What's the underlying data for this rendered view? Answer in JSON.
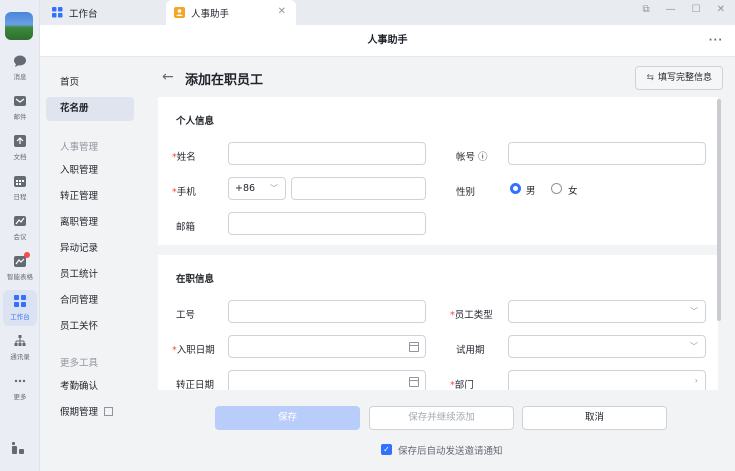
{
  "rail": {
    "items": [
      {
        "label": "消息",
        "icon": "chat-bubble-icon"
      },
      {
        "label": "邮件",
        "icon": "mail-icon"
      },
      {
        "label": "文档",
        "icon": "document-icon"
      },
      {
        "label": "日程",
        "icon": "calendar-icon"
      },
      {
        "label": "会议",
        "icon": "meeting-icon"
      },
      {
        "label": "智能表格",
        "icon": "smart-table-icon"
      },
      {
        "label": "工作台",
        "icon": "workbench-icon"
      },
      {
        "label": "通讯录",
        "icon": "contacts-icon"
      },
      {
        "label": "更多",
        "icon": "more-icon"
      }
    ]
  },
  "tabs": [
    {
      "label": "工作台"
    },
    {
      "label": "人事助手"
    }
  ],
  "app_title": "人事助手",
  "app_more": "···",
  "subnav": {
    "home": "首页",
    "roster": "花名册",
    "group_hr": "人事管理",
    "onboard": "入职管理",
    "regular": "转正管理",
    "leave": "离职管理",
    "change": "异动记录",
    "stats": "员工统计",
    "contract": "合同管理",
    "care": "员工关怀",
    "group_tools": "更多工具",
    "attendance": "考勤确认",
    "holiday": "假期管理"
  },
  "page": {
    "title": "添加在职员工",
    "fill_button": "填写完整信息"
  },
  "personal": {
    "title": "个人信息",
    "name_label": "姓名",
    "account_label": "帐号 ⓘ",
    "phone_label": "手机",
    "phone_code": "+86",
    "gender_label": "性别",
    "gender_male": "男",
    "gender_female": "女",
    "email_label": "邮箱"
  },
  "job": {
    "title": "在职信息",
    "id_label": "工号",
    "type_label": "员工类型",
    "join_label": "入职日期",
    "probation_label": "试用期",
    "regular_label": "转正日期",
    "dept_label": "部门"
  },
  "footer": {
    "save": "保存",
    "save_continue": "保存并继续添加",
    "cancel": "取消",
    "notify": "保存后自动发送邀请通知"
  },
  "colors": {
    "accent": "#3370ff",
    "required": "#f54a45"
  }
}
